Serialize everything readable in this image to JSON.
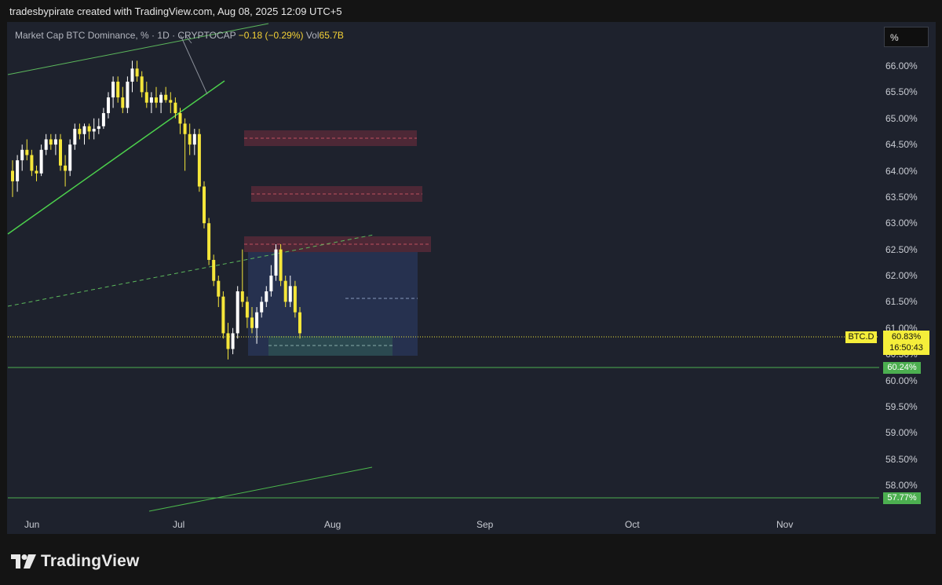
{
  "header": {
    "attribution": "tradesbypirate created with TradingView.com, Aug 08, 2025 12:09 UTC+5"
  },
  "legend": {
    "symbol_desc": "Market Cap BTC Dominance, % · 1D · CRYPTOCAP",
    "change": "−0.18 (−0.29%)",
    "vol_label": "Vol",
    "vol_value": "65.7B"
  },
  "scale_mode": "%",
  "chart_data": {
    "type": "candlestick",
    "symbol": "BTC.D",
    "yticks": [
      "66.00%",
      "65.50%",
      "65.00%",
      "64.50%",
      "64.00%",
      "63.50%",
      "63.00%",
      "62.50%",
      "62.00%",
      "61.50%",
      "61.00%",
      "60.50%",
      "60.00%",
      "59.50%",
      "59.00%",
      "58.50%",
      "58.00%"
    ],
    "xticks": [
      "Jun",
      "Jul",
      "Aug",
      "Sep",
      "Oct",
      "Nov"
    ],
    "ylim": [
      57.6,
      66.3
    ],
    "current_price": "60.83%",
    "countdown": "16:50:43",
    "horizontal_levels": [
      {
        "label": "60.24%",
        "value": 60.24
      },
      {
        "label": "57.77%",
        "value": 57.77
      }
    ],
    "candles": [
      {
        "o": 64.0,
        "h": 64.2,
        "l": 63.5,
        "c": 63.8
      },
      {
        "o": 63.8,
        "h": 64.3,
        "l": 63.6,
        "c": 64.2
      },
      {
        "o": 64.2,
        "h": 64.5,
        "l": 64.0,
        "c": 64.4
      },
      {
        "o": 64.4,
        "h": 64.6,
        "l": 64.2,
        "c": 64.3
      },
      {
        "o": 64.3,
        "h": 64.4,
        "l": 63.9,
        "c": 64.0
      },
      {
        "o": 64.0,
        "h": 64.1,
        "l": 63.8,
        "c": 63.95
      },
      {
        "o": 63.95,
        "h": 64.5,
        "l": 63.9,
        "c": 64.4
      },
      {
        "o": 64.4,
        "h": 64.7,
        "l": 64.3,
        "c": 64.6
      },
      {
        "o": 64.6,
        "h": 64.7,
        "l": 64.4,
        "c": 64.5
      },
      {
        "o": 64.5,
        "h": 64.7,
        "l": 64.3,
        "c": 64.6
      },
      {
        "o": 64.6,
        "h": 64.7,
        "l": 64.0,
        "c": 64.1
      },
      {
        "o": 64.1,
        "h": 64.3,
        "l": 63.7,
        "c": 64.0
      },
      {
        "o": 64.0,
        "h": 64.6,
        "l": 63.9,
        "c": 64.5
      },
      {
        "o": 64.5,
        "h": 64.9,
        "l": 64.4,
        "c": 64.8
      },
      {
        "o": 64.8,
        "h": 64.9,
        "l": 64.6,
        "c": 64.7
      },
      {
        "o": 64.7,
        "h": 64.9,
        "l": 64.5,
        "c": 64.85
      },
      {
        "o": 64.85,
        "h": 64.9,
        "l": 64.6,
        "c": 64.75
      },
      {
        "o": 64.75,
        "h": 65.0,
        "l": 64.6,
        "c": 64.8
      },
      {
        "o": 64.8,
        "h": 65.0,
        "l": 64.7,
        "c": 64.85
      },
      {
        "o": 64.85,
        "h": 65.2,
        "l": 64.8,
        "c": 65.1
      },
      {
        "o": 65.1,
        "h": 65.5,
        "l": 65.0,
        "c": 65.4
      },
      {
        "o": 65.4,
        "h": 65.8,
        "l": 65.2,
        "c": 65.7
      },
      {
        "o": 65.7,
        "h": 65.8,
        "l": 65.3,
        "c": 65.4
      },
      {
        "o": 65.4,
        "h": 65.6,
        "l": 65.1,
        "c": 65.2
      },
      {
        "o": 65.2,
        "h": 65.8,
        "l": 65.1,
        "c": 65.7
      },
      {
        "o": 65.7,
        "h": 66.1,
        "l": 65.5,
        "c": 65.95
      },
      {
        "o": 65.95,
        "h": 66.1,
        "l": 65.7,
        "c": 65.8
      },
      {
        "o": 65.8,
        "h": 65.9,
        "l": 65.4,
        "c": 65.5
      },
      {
        "o": 65.5,
        "h": 65.7,
        "l": 65.2,
        "c": 65.3
      },
      {
        "o": 65.3,
        "h": 65.5,
        "l": 65.1,
        "c": 65.4
      },
      {
        "o": 65.4,
        "h": 65.6,
        "l": 65.2,
        "c": 65.3
      },
      {
        "o": 65.3,
        "h": 65.5,
        "l": 65.1,
        "c": 65.45
      },
      {
        "o": 65.45,
        "h": 65.6,
        "l": 65.3,
        "c": 65.35
      },
      {
        "o": 65.35,
        "h": 65.5,
        "l": 65.1,
        "c": 65.3
      },
      {
        "o": 65.3,
        "h": 65.4,
        "l": 65.0,
        "c": 65.1
      },
      {
        "o": 65.1,
        "h": 65.2,
        "l": 64.7,
        "c": 64.9
      },
      {
        "o": 64.9,
        "h": 65.0,
        "l": 64.0,
        "c": 64.7
      },
      {
        "o": 64.7,
        "h": 64.9,
        "l": 64.3,
        "c": 64.5
      },
      {
        "o": 64.5,
        "h": 64.8,
        "l": 64.3,
        "c": 64.7
      },
      {
        "o": 64.7,
        "h": 64.8,
        "l": 63.6,
        "c": 63.7
      },
      {
        "o": 63.7,
        "h": 63.8,
        "l": 62.9,
        "c": 63.0
      },
      {
        "o": 63.0,
        "h": 63.1,
        "l": 62.2,
        "c": 62.3
      },
      {
        "o": 62.3,
        "h": 62.4,
        "l": 61.8,
        "c": 61.9
      },
      {
        "o": 61.9,
        "h": 62.0,
        "l": 61.4,
        "c": 61.6
      },
      {
        "o": 61.6,
        "h": 61.7,
        "l": 60.8,
        "c": 60.9
      },
      {
        "o": 60.9,
        "h": 61.1,
        "l": 60.4,
        "c": 60.6
      },
      {
        "o": 60.6,
        "h": 61.0,
        "l": 60.5,
        "c": 60.9
      },
      {
        "o": 60.9,
        "h": 61.8,
        "l": 60.8,
        "c": 61.7
      },
      {
        "o": 61.7,
        "h": 62.5,
        "l": 61.4,
        "c": 61.5
      },
      {
        "o": 61.5,
        "h": 61.6,
        "l": 61.0,
        "c": 61.2
      },
      {
        "o": 61.2,
        "h": 61.4,
        "l": 60.9,
        "c": 61.0
      },
      {
        "o": 61.0,
        "h": 61.4,
        "l": 60.7,
        "c": 61.3
      },
      {
        "o": 61.3,
        "h": 61.6,
        "l": 61.2,
        "c": 61.5
      },
      {
        "o": 61.5,
        "h": 61.8,
        "l": 61.4,
        "c": 61.7
      },
      {
        "o": 61.7,
        "h": 62.2,
        "l": 61.6,
        "c": 62.0
      },
      {
        "o": 62.0,
        "h": 62.6,
        "l": 61.9,
        "c": 62.5
      },
      {
        "o": 62.5,
        "h": 62.6,
        "l": 61.8,
        "c": 61.9
      },
      {
        "o": 61.9,
        "h": 62.0,
        "l": 61.4,
        "c": 61.5
      },
      {
        "o": 61.5,
        "h": 62.0,
        "l": 61.4,
        "c": 61.8
      },
      {
        "o": 61.8,
        "h": 61.9,
        "l": 61.2,
        "c": 61.3
      },
      {
        "o": 61.3,
        "h": 61.4,
        "l": 60.8,
        "c": 60.9
      }
    ]
  }
}
